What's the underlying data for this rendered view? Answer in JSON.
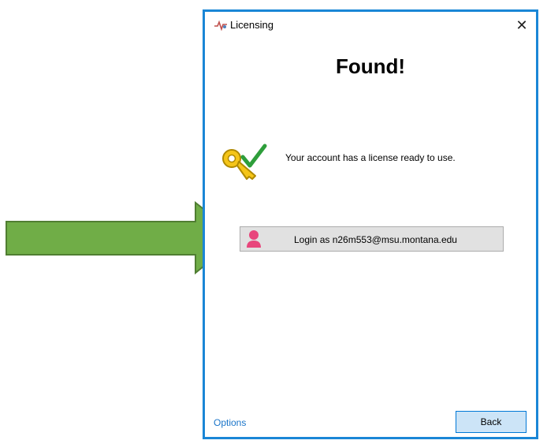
{
  "window": {
    "title": "Licensing",
    "close_label": "✕",
    "heading": "Found!",
    "message": "Your account has a license ready to use.",
    "login_button_label": "Login as n26m553@msu.montana.edu",
    "options_link": "Options",
    "back_button_label": "Back"
  },
  "icons": {
    "app": "licensing-app-icon",
    "key": "key-check-icon",
    "avatar": "user-avatar-icon",
    "arrow": "arrow-right-icon"
  },
  "colors": {
    "window_border": "#1a86d6",
    "arrow_fill": "#70ad47",
    "arrow_stroke": "#507e32",
    "avatar": "#e8467c",
    "key": "#f5c518",
    "check": "#2e9e3b",
    "back_button_bg": "#cce4f7",
    "link": "#1a75c9"
  }
}
